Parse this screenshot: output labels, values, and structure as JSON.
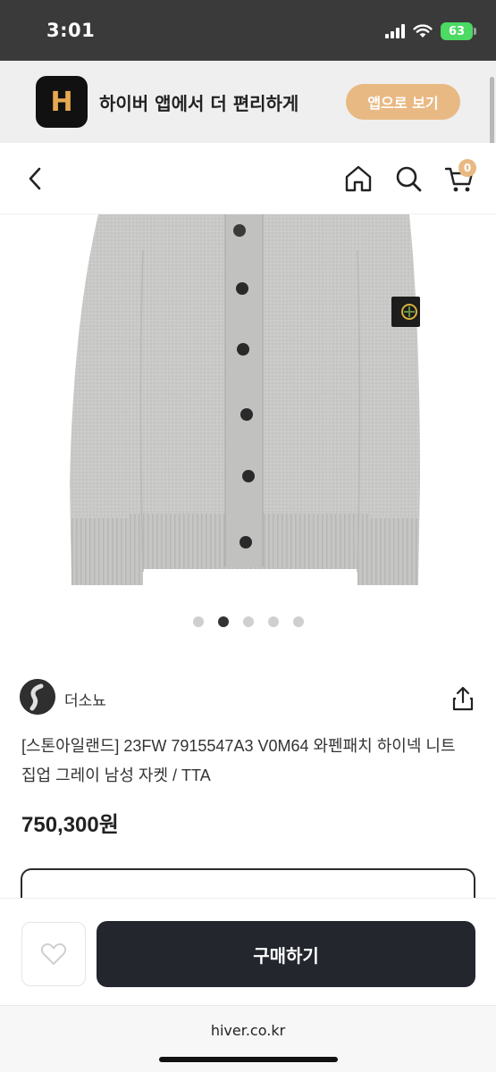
{
  "status_bar": {
    "time": "3:01",
    "battery": "63"
  },
  "app_banner": {
    "logo_letter": "H",
    "text": "하이버 앱에서 더 편리하게",
    "button_label": "앱으로 보기"
  },
  "nav": {
    "cart_count": "0",
    "icons": [
      "chevron-left-icon",
      "home-icon",
      "search-icon",
      "cart-icon"
    ]
  },
  "product": {
    "image": {
      "description_icon": "gray-knit-cardigan",
      "carousel_total": 5,
      "carousel_active": 2
    },
    "seller": {
      "name": "더소뇨"
    },
    "title": "[스톤아일랜드] 23FW 7915547A3 V0M64 와펜패치 하이넥 니트 집업 그레이 남성 자켓 / TTA",
    "price": "750,300원"
  },
  "bottom_bar": {
    "buy_label": "구매하기"
  },
  "browser": {
    "url": "hiver.co.kr"
  },
  "colors": {
    "accent": "#e9b983",
    "dark_button": "#23262d",
    "status_bar": "#3a3a3a"
  }
}
